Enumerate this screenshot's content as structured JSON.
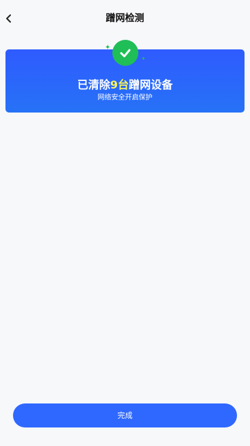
{
  "header": {
    "title": "蹭网检测",
    "back_icon": "chevron-left-icon"
  },
  "banner": {
    "status_icon": "check-circle-icon",
    "headline_prefix": "已清除",
    "headline_count": "9台",
    "headline_suffix": "蹭网设备",
    "subline": "网络安全开启保护",
    "colors": {
      "banner_blue": "#2f5bff",
      "check_green": "#1fbe57",
      "highlight_yellow": "#f6f55b"
    }
  },
  "footer": {
    "done_label": "完成",
    "button_color": "#2f68ff"
  }
}
